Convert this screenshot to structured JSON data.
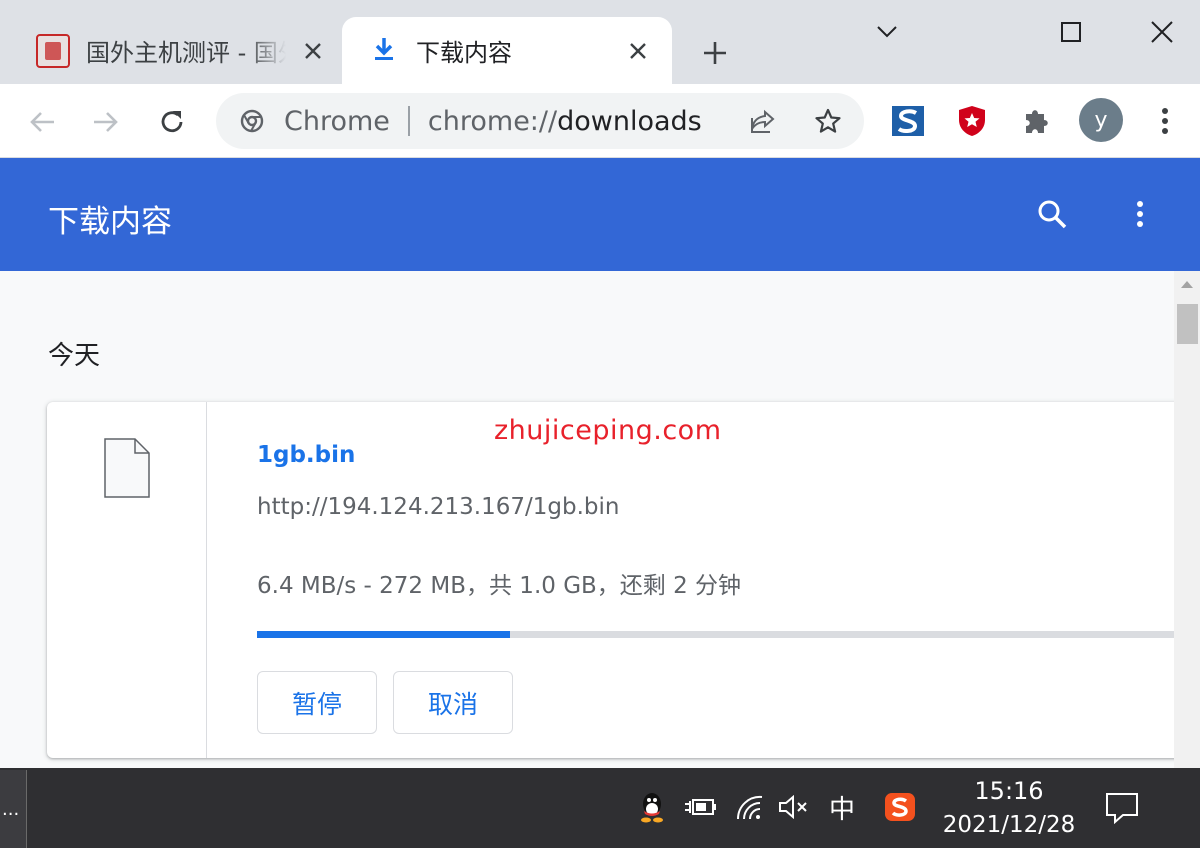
{
  "browser": {
    "tabs": [
      {
        "title": "国外主机测评 - 国外",
        "active": false,
        "icon": "site-favicon"
      },
      {
        "title": "下载内容",
        "active": true,
        "icon": "download-icon"
      }
    ],
    "omnibox": {
      "scheme_label": "Chrome",
      "url_prefix": "chrome://",
      "url_host": "downloads"
    },
    "profile_initial": "y"
  },
  "downloads": {
    "header_title": "下载内容",
    "date_heading": "今天",
    "items": [
      {
        "file_name": "1gb.bin",
        "url": "http://194.124.213.167/1gb.bin",
        "status": "6.4 MB/s - 272 MB，共 1.0 GB，还剩 2 分钟",
        "progress_fraction": 0.272,
        "pause_label": "暂停",
        "cancel_label": "取消"
      }
    ]
  },
  "watermark": "zhujiceping.com",
  "taskbar": {
    "left_label": "...",
    "ime_label": "中",
    "time": "15:16",
    "date": "2021/12/28"
  },
  "colors": {
    "header_blue": "#3367d6",
    "link_blue": "#1a73e8",
    "watermark_red": "#e8212b"
  }
}
